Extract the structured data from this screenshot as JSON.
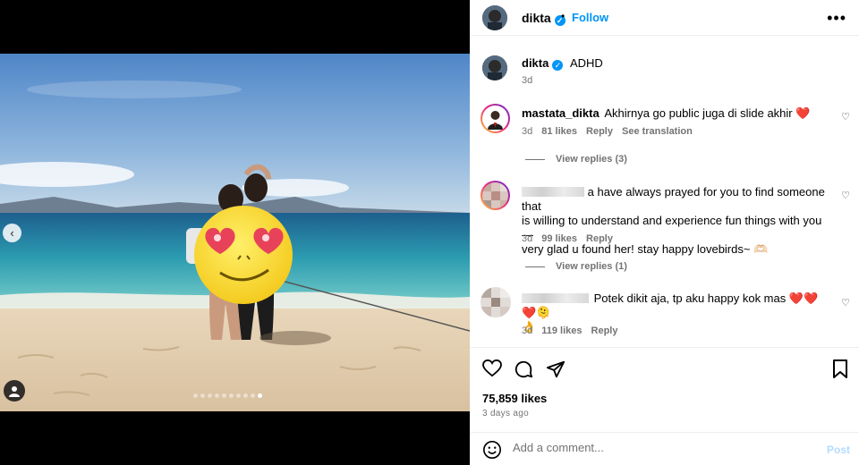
{
  "post": {
    "username": "dikta",
    "follow_label": "Follow",
    "more_icon": "more-horizontal-icon",
    "caption": "ADHD",
    "caption_time": "3d"
  },
  "media": {
    "dot_count": 10,
    "active_dot": 9,
    "prev_icon": "chevron-left-icon",
    "user_tag_icon": "user-tag-icon"
  },
  "comments": [
    {
      "username": "mastata_dikta",
      "text": "Akhirnya go public juga di slide akhir ❤️",
      "time": "3d",
      "likes": "81 likes",
      "reply_label": "Reply",
      "translate_label": "See translation",
      "view_replies": "View replies (3)"
    },
    {
      "username": "",
      "text_line1": "a have always prayed for you to find someone that",
      "text_line2": "is willing to understand and experience fun things with you—",
      "text_line3": "very glad u found her! stay happy lovebirds~ 🫶🏻",
      "time": "3d",
      "likes": "99 likes",
      "reply_label": "Reply",
      "view_replies": "View replies (1)"
    },
    {
      "username": "",
      "text": "Potek dikit aja, tp aku happy kok mas ❤️❤️❤️🫠",
      "text_line2": "👌",
      "time": "3d",
      "likes": "119 likes",
      "reply_label": "Reply"
    }
  ],
  "actions": {
    "like_icon": "heart-icon",
    "comment_icon": "comment-icon",
    "share_icon": "send-icon",
    "save_icon": "bookmark-icon",
    "likes_count": "75,859 likes",
    "posted": "3 days ago"
  },
  "composer": {
    "placeholder": "Add a comment...",
    "post_label": "Post",
    "emoji_icon": "emoji-icon"
  },
  "colors": {
    "accent": "#0095f6",
    "secondary_text": "#737373",
    "post_disabled": "#b3dbff"
  }
}
